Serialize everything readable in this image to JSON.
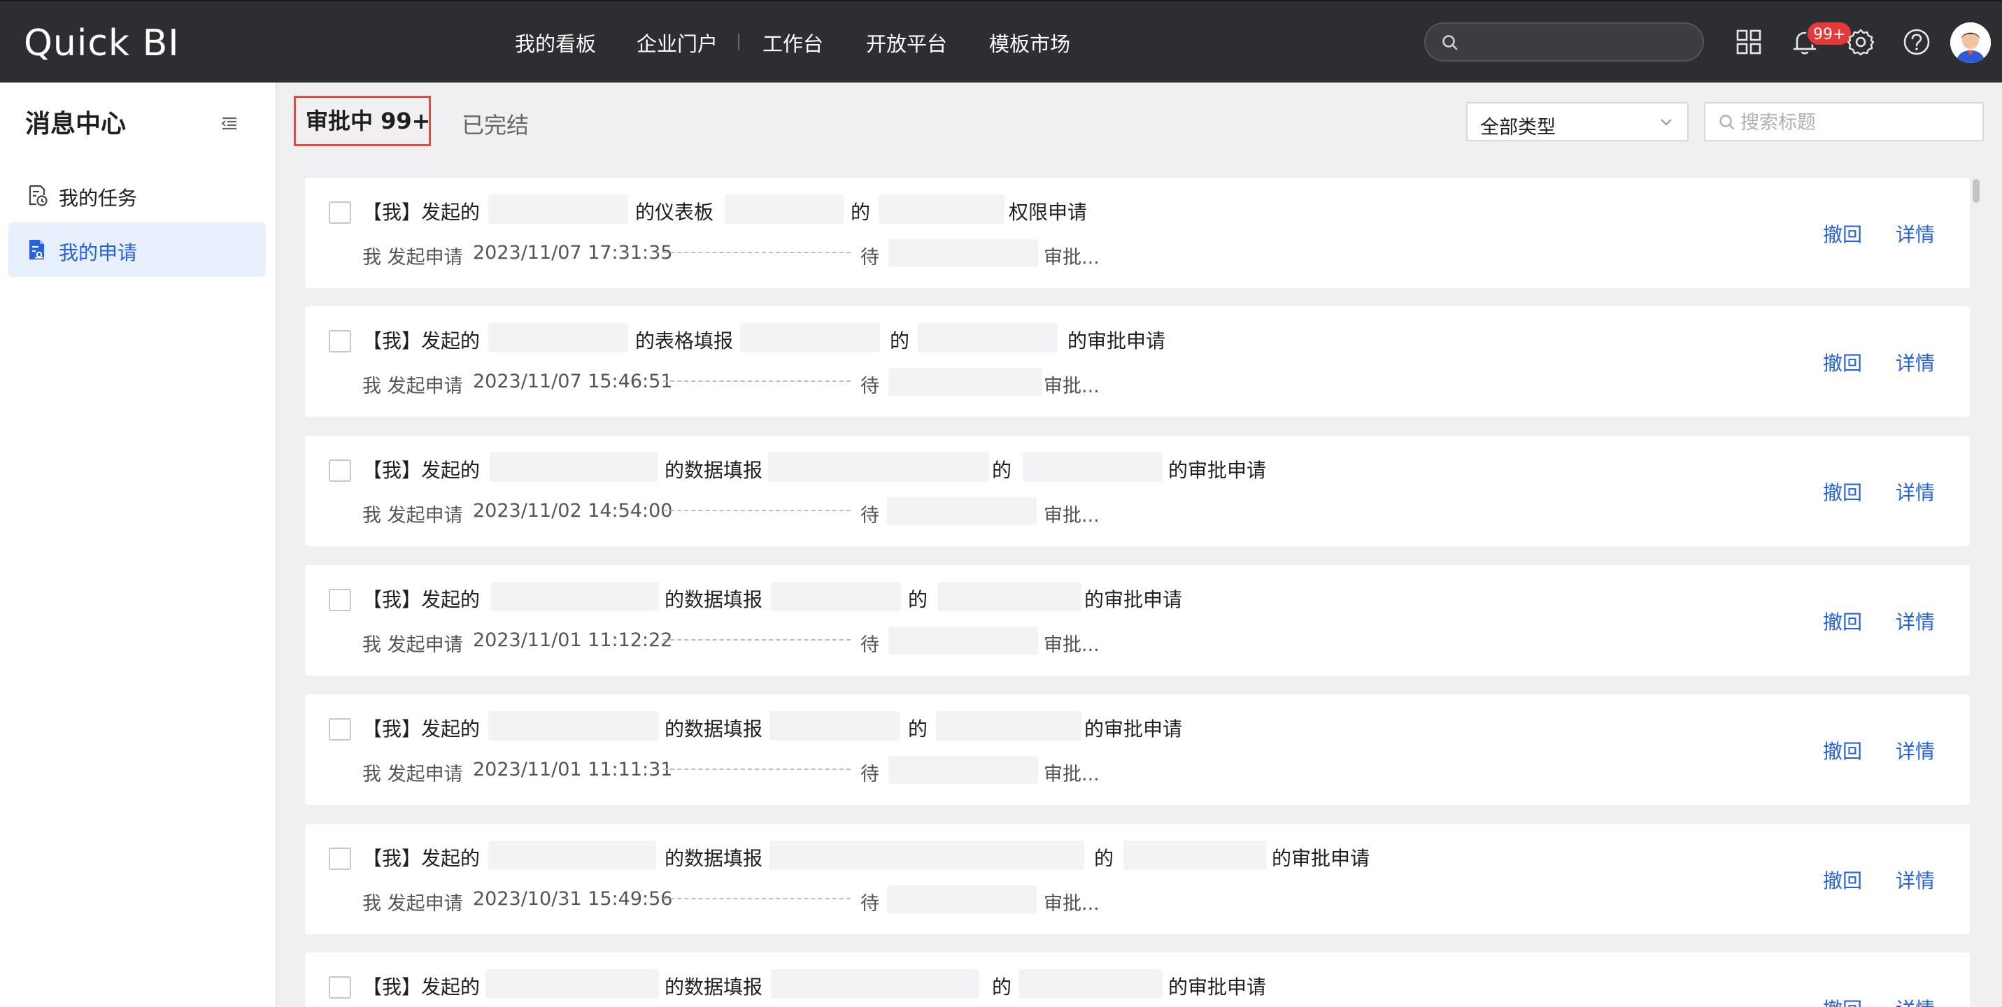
{
  "app": {
    "logo_text": "Quick BI"
  },
  "topnav": {
    "items": [
      {
        "label": "我的看板"
      },
      {
        "label": "企业门户"
      },
      {
        "label": "工作台"
      },
      {
        "label": "开放平台"
      },
      {
        "label": "模板市场"
      }
    ],
    "search_placeholder": "",
    "notification_badge": "99+",
    "icons": [
      "search-icon",
      "apps-grid-icon",
      "bell-icon",
      "gear-icon",
      "help-icon",
      "avatar"
    ]
  },
  "sidebar": {
    "title": "消息中心",
    "items": [
      {
        "label": "我的任务",
        "icon": "task-icon",
        "active": false
      },
      {
        "label": "我的申请",
        "icon": "application-icon",
        "active": true
      }
    ]
  },
  "tabs": {
    "active": "审批中 99+",
    "done": "已完结"
  },
  "filters": {
    "type_select_value": "全部类型",
    "title_search_placeholder": "搜索标题"
  },
  "colors": {
    "accent": "#2561e8",
    "topbar": "#2d2e31",
    "badge": "#e63a3a",
    "tab_outline": "#e24c3d"
  },
  "requests": [
    {
      "prefix": "【我】发起的",
      "object_type": "的仪表板",
      "of": "的",
      "suffix": "权限申请",
      "initiator": "我 发起申请",
      "time": "2023/11/07 17:31:35",
      "wait": "待",
      "status": "审批...",
      "withdraw": "撤回",
      "detail": "详情"
    },
    {
      "prefix": "【我】发起的",
      "object_type": "的表格填报",
      "of": "的",
      "suffix": "的审批申请",
      "initiator": "我 发起申请",
      "time": "2023/11/07 15:46:51",
      "wait": "待",
      "status": "审批...",
      "withdraw": "撤回",
      "detail": "详情"
    },
    {
      "prefix": "【我】发起的",
      "object_type": "的数据填报",
      "of": "的",
      "suffix": "的审批申请",
      "initiator": "我 发起申请",
      "time": "2023/11/02 14:54:00",
      "wait": "待",
      "status": "审批...",
      "withdraw": "撤回",
      "detail": "详情"
    },
    {
      "prefix": "【我】发起的",
      "object_type": "的数据填报",
      "of": "的",
      "suffix": "的审批申请",
      "initiator": "我 发起申请",
      "time": "2023/11/01 11:12:22",
      "wait": "待",
      "status": "审批...",
      "withdraw": "撤回",
      "detail": "详情"
    },
    {
      "prefix": "【我】发起的",
      "object_type": "的数据填报",
      "of": "的",
      "suffix": "的审批申请",
      "initiator": "我 发起申请",
      "time": "2023/11/01 11:11:31",
      "wait": "待",
      "status": "审批...",
      "withdraw": "撤回",
      "detail": "详情"
    },
    {
      "prefix": "【我】发起的",
      "object_type": "的数据填报",
      "of": "的",
      "suffix": "的审批申请",
      "initiator": "我 发起申请",
      "time": "2023/10/31 15:49:56",
      "wait": "待",
      "status": "审批...",
      "withdraw": "撤回",
      "detail": "详情"
    },
    {
      "prefix": "【我】发起的",
      "object_type": "的数据填报",
      "of": "的",
      "suffix": "的审批申请",
      "initiator": "",
      "time": "",
      "wait": "",
      "status": "",
      "withdraw": "撤回",
      "detail": "详情"
    }
  ]
}
